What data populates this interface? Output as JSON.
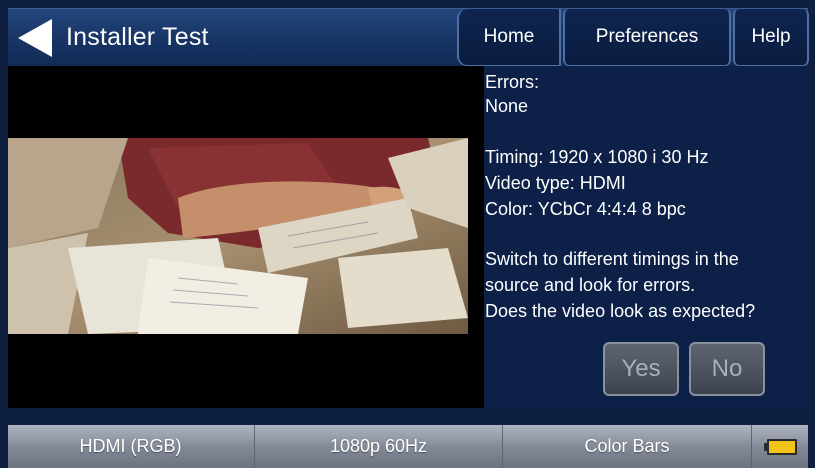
{
  "header": {
    "title": "Installer Test",
    "tabs": [
      {
        "label": "Home"
      },
      {
        "label": "Preferences"
      },
      {
        "label": "Help"
      }
    ]
  },
  "info": {
    "errors_label": "Errors:",
    "errors_value": "None",
    "timing": "Timing: 1920 x 1080 i 30 Hz",
    "video_type": "Video type: HDMI",
    "color": "Color: YCbCr 4:4:4 8 bpc",
    "instructions": [
      "Switch to different timings in the",
      "source and look for errors.",
      "Does the video look as expected?"
    ],
    "yes_label": "Yes",
    "no_label": "No"
  },
  "status_bar": {
    "input": "HDMI (RGB)",
    "format": "1080p 60Hz",
    "pattern": "Color Bars"
  },
  "icons": {
    "back": "back-arrow-icon",
    "battery": "battery-icon"
  },
  "colors": {
    "background": "#0e1f40",
    "title_bar": "#173464",
    "button_disabled": "#4a505c",
    "battery_fill": "#f0c419"
  }
}
